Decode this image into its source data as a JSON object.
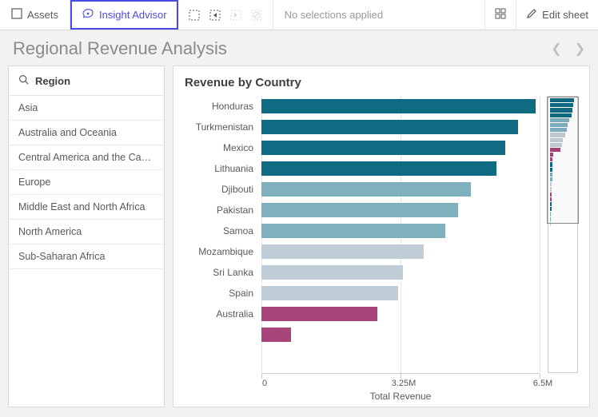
{
  "toolbar": {
    "assets_label": "Assets",
    "insight_label": "Insight Advisor",
    "no_selections_label": "No selections applied",
    "edit_label": "Edit sheet"
  },
  "page_title": "Regional Revenue Analysis",
  "filter": {
    "title": "Region",
    "items": [
      "Asia",
      "Australia and Oceania",
      "Central America and the Carib…",
      "Europe",
      "Middle East and North Africa",
      "North America",
      "Sub-Saharan Africa"
    ]
  },
  "colors": {
    "teal_dark": "#0f6b82",
    "teal_mid": "#7fb0bf",
    "gray_blue": "#c0cdd6",
    "magenta": "#a7457a"
  },
  "chart_data": {
    "type": "bar",
    "orientation": "horizontal",
    "title": "Revenue by Country",
    "xlabel": "Total Revenue",
    "ylabel": "",
    "xlim": [
      0,
      6500000
    ],
    "ticks": [
      {
        "pos": 0,
        "label": "0"
      },
      {
        "pos": 3250000,
        "label": "3.25M"
      },
      {
        "pos": 6500000,
        "label": "6.5M"
      }
    ],
    "series": [
      {
        "name": "Honduras",
        "value": 6400000,
        "color": "teal_dark"
      },
      {
        "name": "Turkmenistan",
        "value": 6000000,
        "color": "teal_dark"
      },
      {
        "name": "Mexico",
        "value": 5700000,
        "color": "teal_dark"
      },
      {
        "name": "Lithuania",
        "value": 5500000,
        "color": "teal_dark"
      },
      {
        "name": "Djibouti",
        "value": 4900000,
        "color": "teal_mid"
      },
      {
        "name": "Pakistan",
        "value": 4600000,
        "color": "teal_mid"
      },
      {
        "name": "Samoa",
        "value": 4300000,
        "color": "teal_mid"
      },
      {
        "name": "Mozambique",
        "value": 3800000,
        "color": "gray_blue"
      },
      {
        "name": "Sri Lanka",
        "value": 3300000,
        "color": "gray_blue"
      },
      {
        "name": "Spain",
        "value": 3200000,
        "color": "gray_blue"
      },
      {
        "name": "Australia",
        "value": 2700000,
        "color": "magenta"
      },
      {
        "name": "",
        "value": 700000,
        "color": "magenta"
      }
    ],
    "minimap": [
      {
        "w": 0.95,
        "color": "teal_dark"
      },
      {
        "w": 0.9,
        "color": "teal_dark"
      },
      {
        "w": 0.86,
        "color": "teal_dark"
      },
      {
        "w": 0.83,
        "color": "teal_dark"
      },
      {
        "w": 0.74,
        "color": "teal_mid"
      },
      {
        "w": 0.7,
        "color": "teal_mid"
      },
      {
        "w": 0.66,
        "color": "teal_mid"
      },
      {
        "w": 0.58,
        "color": "gray_blue"
      },
      {
        "w": 0.5,
        "color": "gray_blue"
      },
      {
        "w": 0.48,
        "color": "gray_blue"
      },
      {
        "w": 0.4,
        "color": "magenta"
      },
      {
        "w": 0.12,
        "color": "magenta"
      },
      {
        "w": 0.1,
        "color": "magenta"
      },
      {
        "w": 0.09,
        "color": "teal_dark"
      },
      {
        "w": 0.09,
        "color": "teal_dark"
      },
      {
        "w": 0.08,
        "color": "teal_mid"
      },
      {
        "w": 0.08,
        "color": "teal_mid"
      },
      {
        "w": 0.07,
        "color": "gray_blue"
      },
      {
        "w": 0.07,
        "color": "gray_blue"
      },
      {
        "w": 0.06,
        "color": "magenta"
      },
      {
        "w": 0.06,
        "color": "magenta"
      },
      {
        "w": 0.05,
        "color": "teal_dark"
      },
      {
        "w": 0.05,
        "color": "teal_dark"
      },
      {
        "w": 0.04,
        "color": "teal_mid"
      },
      {
        "w": 0.04,
        "color": "teal_mid"
      },
      {
        "w": 0.03,
        "color": "gray_blue"
      }
    ]
  }
}
